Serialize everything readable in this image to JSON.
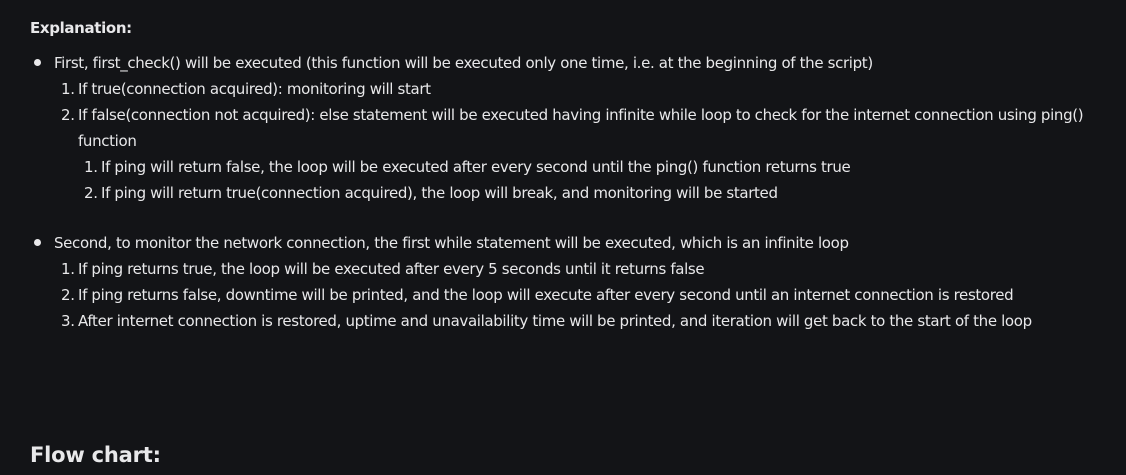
{
  "explanation_heading": "Explanation:",
  "bullets": [
    {
      "text": "First, first_check() will be executed (this function will be executed only one time, i.e. at the beginning of the script)",
      "items": [
        {
          "num": "1.",
          "text": "If true(connection acquired): monitoring will start"
        },
        {
          "num": "2.",
          "text": "If false(connection not acquired): else statement will be executed having infinite while loop to check for the internet connection using ping() function",
          "subitems": [
            {
              "num": "1.",
              "text": "If ping will return false, the loop will be executed after every second until the ping() function returns true"
            },
            {
              "num": "2.",
              "text": "If ping will return true(connection acquired), the loop will break, and monitoring will be started"
            }
          ]
        }
      ]
    },
    {
      "text": "Second, to monitor the network connection, the first while statement will be executed, which is an infinite loop",
      "items": [
        {
          "num": "1.",
          "text": "If ping returns true, the loop will be executed after every 5 seconds until it returns false"
        },
        {
          "num": "2.",
          "text": "If ping returns false, downtime will be printed, and the loop will execute after every second until an internet connection is restored"
        },
        {
          "num": "3.",
          "text": "After internet connection is restored, uptime and unavailability time will be printed, and iteration will get back to the start of the loop"
        }
      ]
    }
  ],
  "flow_chart_heading": "Flow chart:"
}
